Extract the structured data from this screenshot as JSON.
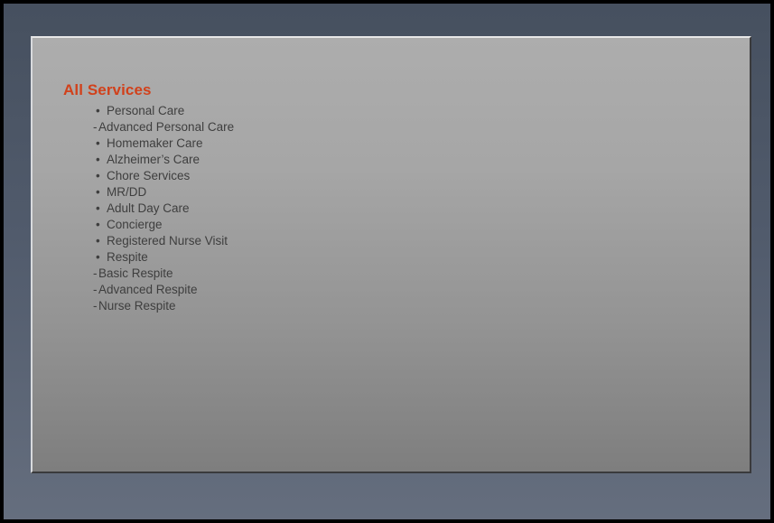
{
  "slide": {
    "title": "All Services",
    "title_color": "#d1411b",
    "body_text_color": "#3e3e3e",
    "frame_color": "#515b6c",
    "panel_color_top": "#adadad",
    "panel_color_bottom": "#7e7e7e",
    "items": [
      {
        "marker": "•",
        "label": "Personal Care",
        "level": "bullet"
      },
      {
        "marker": "-",
        "label": "Advanced Personal Care",
        "level": "dash"
      },
      {
        "marker": "•",
        "label": "Homemaker Care",
        "level": "bullet"
      },
      {
        "marker": "•",
        "label": "Alzheimer’s Care",
        "level": "bullet"
      },
      {
        "marker": "•",
        "label": "Chore Services",
        "level": "bullet"
      },
      {
        "marker": "•",
        "label": "MR/DD",
        "level": "bullet"
      },
      {
        "marker": "•",
        "label": "Adult Day Care",
        "level": "bullet"
      },
      {
        "marker": "•",
        "label": "Concierge",
        "level": "bullet"
      },
      {
        "marker": "•",
        "label": "Registered Nurse Visit",
        "level": "bullet"
      },
      {
        "marker": "•",
        "label": "Respite",
        "level": "bullet"
      },
      {
        "marker": "-",
        "label": "Basic Respite",
        "level": "dash"
      },
      {
        "marker": "-",
        "label": "Advanced Respite",
        "level": "dash"
      },
      {
        "marker": "-",
        "label": "Nurse Respite",
        "level": "dash"
      }
    ]
  }
}
